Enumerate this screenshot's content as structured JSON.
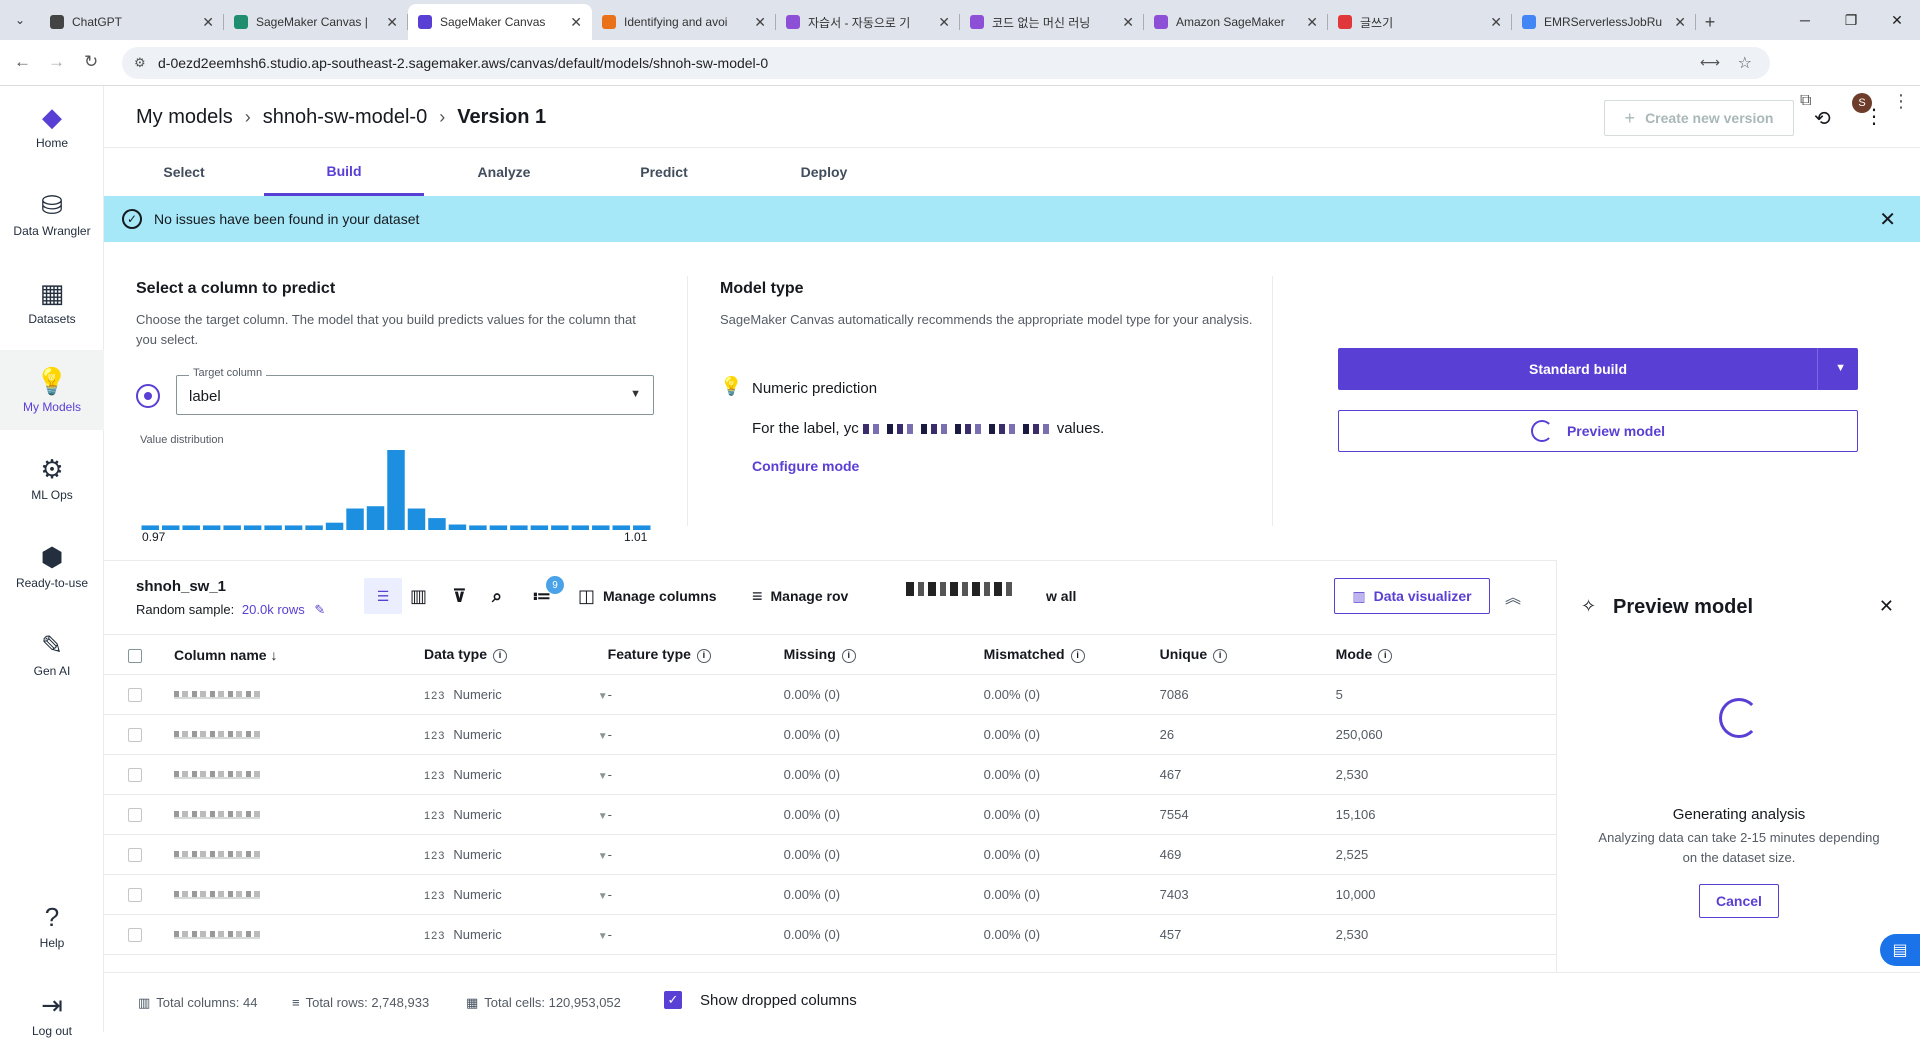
{
  "browser": {
    "tabs": [
      {
        "title": "ChatGPT",
        "favicon_color": "#444444"
      },
      {
        "title": "SageMaker Canvas |",
        "favicon_color": "#1e8e6e"
      },
      {
        "title": "SageMaker Canvas",
        "favicon_color": "#5a3fd4",
        "active": true
      },
      {
        "title": "Identifying and avoi",
        "favicon_color": "#e8711a"
      },
      {
        "title": "자습서 - 자동으로 기",
        "favicon_color": "#8c4fd6"
      },
      {
        "title": "코드 없는 머신 러닝",
        "favicon_color": "#8c4fd6"
      },
      {
        "title": "Amazon SageMaker",
        "favicon_color": "#8c4fd6"
      },
      {
        "title": "글쓰기",
        "favicon_color": "#e0383a"
      },
      {
        "title": "EMRServerlessJobRu",
        "favicon_color": "#4285f4"
      }
    ],
    "url": "d-0ezd2eemhsh6.studio.ap-southeast-2.sagemaker.aws/canvas/default/models/shnoh-sw-model-0",
    "profile_initial": "S"
  },
  "sidenav": [
    {
      "label": "Home",
      "icon": "canvas-logo-icon"
    },
    {
      "label": "Data Wrangler",
      "icon": "database-icon"
    },
    {
      "label": "Datasets",
      "icon": "table-icon"
    },
    {
      "label": "My Models",
      "icon": "bulb-icon",
      "active": true
    },
    {
      "label": "ML Ops",
      "icon": "gear-icon"
    },
    {
      "label": "Ready-to-use",
      "icon": "box-icon"
    },
    {
      "label": "Gen AI",
      "icon": "chat-icon"
    },
    {
      "label": "Help",
      "icon": "help-icon"
    },
    {
      "label": "Log out",
      "icon": "logout-icon"
    }
  ],
  "breadcrumb": {
    "b1": "My models",
    "b2": "shnoh-sw-model-0",
    "b3": "Version 1"
  },
  "create_version": "Create new version",
  "steps": [
    "Select",
    "Build",
    "Analyze",
    "Predict",
    "Deploy"
  ],
  "active_step": "Build",
  "banner": "No issues have been found in your dataset",
  "target": {
    "title": "Select a column to predict",
    "desc": "Choose the target column. The model that you build predicts values for the column that you select.",
    "field_label": "Target column",
    "value": "label",
    "dist_label": "Value distribution",
    "min": "0.97",
    "max": "1.01"
  },
  "model_type": {
    "title": "Model type",
    "desc": "SageMaker Canvas automatically recommends the appropriate model type for your analysis.",
    "name": "Numeric prediction",
    "prefix": "For the label, yc",
    "suffix": "values.",
    "configure": "Configure mode"
  },
  "actions": {
    "standard_build": "Standard build",
    "preview_model": "Preview model"
  },
  "dataset": {
    "name": "shnoh_sw_1",
    "sample_label": "Random sample:",
    "sample_rows": "20.0k rows",
    "manage_columns": "Manage columns",
    "manage_rows": "Manage rov",
    "show_all": "w all",
    "badge": "9",
    "data_visualizer": "Data visualizer"
  },
  "table": {
    "headers": {
      "name": "Column name",
      "dtype": "Data type",
      "ftype": "Feature type",
      "missing": "Missing",
      "mismatched": "Mismatched",
      "unique": "Unique",
      "mode": "Mode"
    },
    "rows": [
      {
        "dtype_abbr": "123",
        "dtype": "Numeric",
        "ftype": "-",
        "missing": "0.00% (0)",
        "mismatched": "0.00% (0)",
        "unique": "7086",
        "mode": "5"
      },
      {
        "dtype_abbr": "123",
        "dtype": "Numeric",
        "ftype": "-",
        "missing": "0.00% (0)",
        "mismatched": "0.00% (0)",
        "unique": "26",
        "mode": "250,060"
      },
      {
        "dtype_abbr": "123",
        "dtype": "Numeric",
        "ftype": "-",
        "missing": "0.00% (0)",
        "mismatched": "0.00% (0)",
        "unique": "467",
        "mode": "2,530"
      },
      {
        "dtype_abbr": "123",
        "dtype": "Numeric",
        "ftype": "-",
        "missing": "0.00% (0)",
        "mismatched": "0.00% (0)",
        "unique": "7554",
        "mode": "15,106"
      },
      {
        "dtype_abbr": "123",
        "dtype": "Numeric",
        "ftype": "-",
        "missing": "0.00% (0)",
        "mismatched": "0.00% (0)",
        "unique": "469",
        "mode": "2,525"
      },
      {
        "dtype_abbr": "123",
        "dtype": "Numeric",
        "ftype": "-",
        "missing": "0.00% (0)",
        "mismatched": "0.00% (0)",
        "unique": "7403",
        "mode": "10,000"
      },
      {
        "dtype_abbr": "123",
        "dtype": "Numeric",
        "ftype": "-",
        "missing": "0.00% (0)",
        "mismatched": "0.00% (0)",
        "unique": "457",
        "mode": "2,530"
      }
    ]
  },
  "preview_panel": {
    "title": "Preview model",
    "generating": "Generating analysis",
    "sub": "Analyzing data can take 2-15 minutes depending on the dataset size.",
    "cancel": "Cancel"
  },
  "footer": {
    "columns": "Total columns: 44",
    "rows": "Total rows: 2,748,933",
    "cells": "Total cells: 120,953,052",
    "show_dropped": "Show dropped columns"
  },
  "chart_data": {
    "type": "bar",
    "values": [
      1,
      1,
      1,
      1,
      1,
      1,
      1,
      1,
      1,
      1.6,
      4.7,
      5.2,
      17.5,
      4.7,
      2.6,
      1.2,
      1,
      1,
      1,
      1,
      1,
      1,
      1,
      1,
      1
    ],
    "xlim_labels": [
      "0.97",
      "1.01"
    ],
    "color": "#1d8fe0"
  }
}
